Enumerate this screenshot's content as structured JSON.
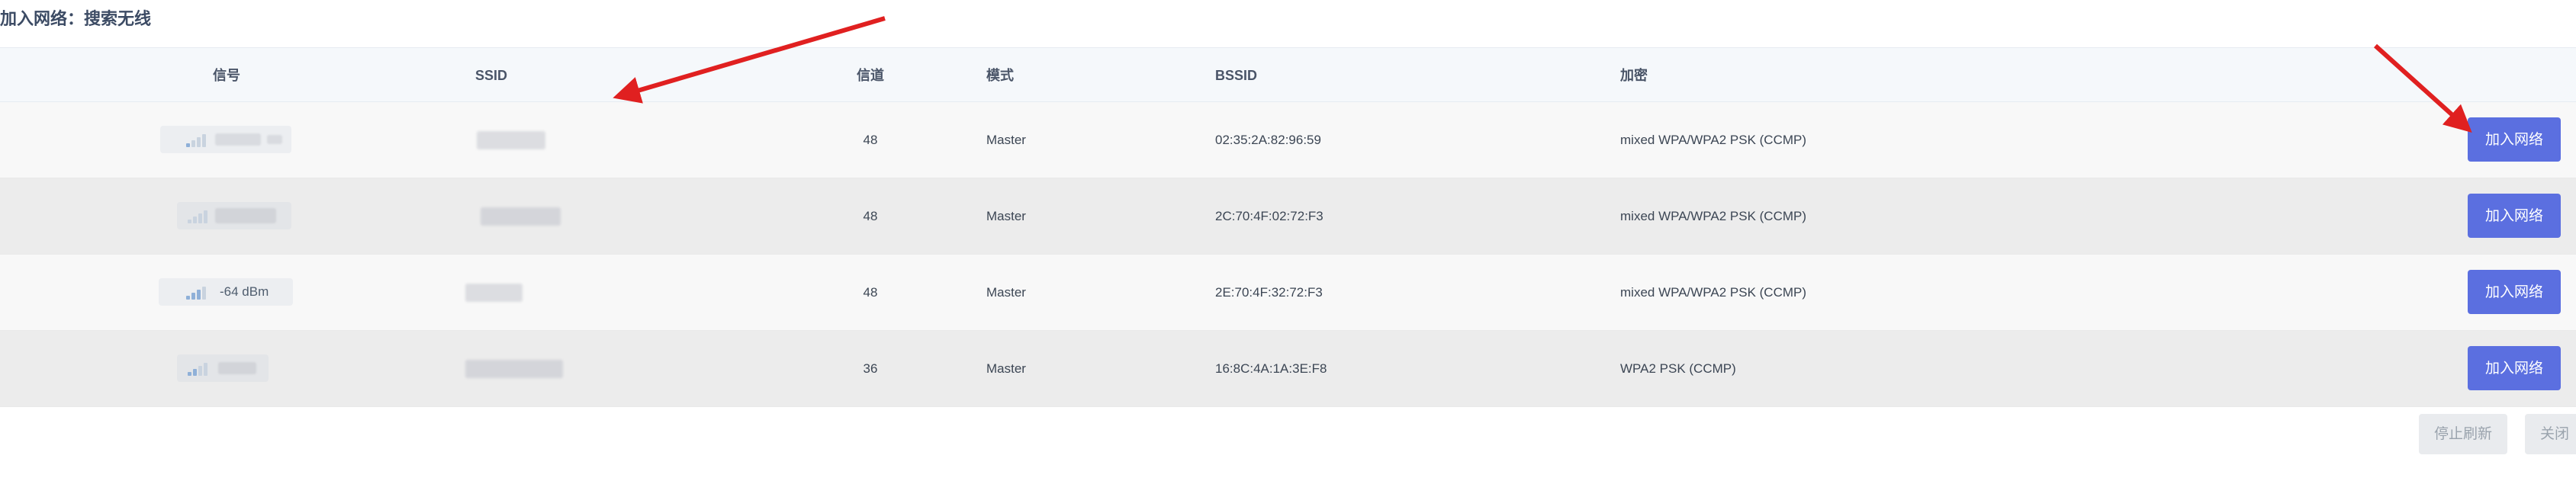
{
  "page_title": "加入网络：搜索无线",
  "columns": {
    "signal": "信号",
    "ssid": "SSID",
    "channel": "信道",
    "mode": "模式",
    "bssid": "BSSID",
    "encryption": "加密"
  },
  "rows": [
    {
      "signal_text": "",
      "signal_level": 1,
      "channel": "48",
      "mode": "Master",
      "bssid": "02:35:2A:82:96:59",
      "encryption": "mixed WPA/WPA2 PSK (CCMP)",
      "action": "加入网络"
    },
    {
      "signal_text": "",
      "signal_level": 1,
      "channel": "48",
      "mode": "Master",
      "bssid": "2C:70:4F:02:72:F3",
      "encryption": "mixed WPA/WPA2 PSK (CCMP)",
      "action": "加入网络"
    },
    {
      "signal_text": "-64 dBm",
      "signal_level": 3,
      "channel": "48",
      "mode": "Master",
      "bssid": "2E:70:4F:32:72:F3",
      "encryption": "mixed WPA/WPA2 PSK (CCMP)",
      "action": "加入网络"
    },
    {
      "signal_text": "",
      "signal_level": 2,
      "channel": "36",
      "mode": "Master",
      "bssid": "16:8C:4A:1A:3E:F8",
      "encryption": "WPA2 PSK (CCMP)",
      "action": "加入网络"
    }
  ],
  "footer": {
    "stop_refresh": "停止刷新",
    "close": "关闭"
  },
  "colors": {
    "accent": "#5b6fe0",
    "annotation_arrow": "#e02020"
  }
}
